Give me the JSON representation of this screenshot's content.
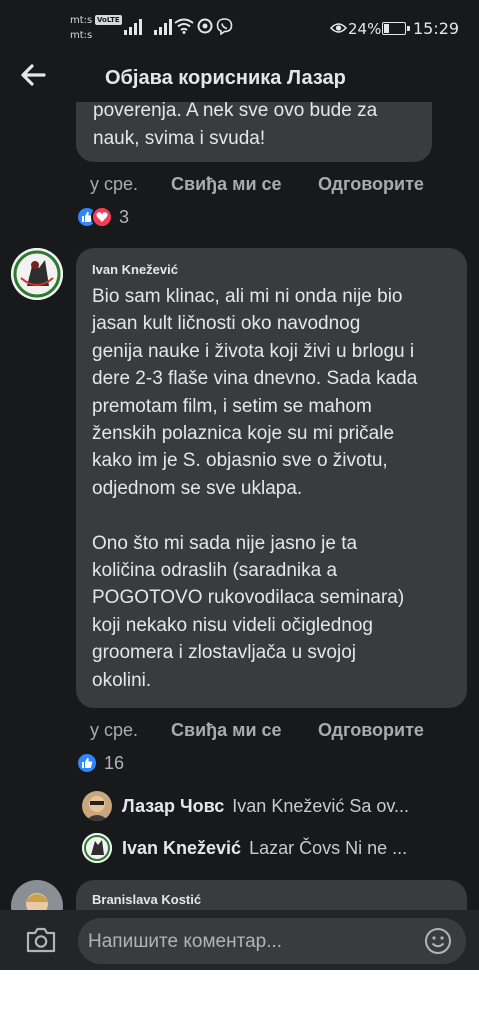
{
  "status_bar": {
    "operator_1": "mt:s",
    "operator_2": "mt:s",
    "volte_badge": "VoLTE",
    "battery_percent": "24%",
    "battery_level": 0.24,
    "time": "15:29"
  },
  "header": {
    "title": "Објава корисника Лазар"
  },
  "previous_comment": {
    "text": "poverenja. A nek sve ovo bude za\nnauk, svima i svuda!",
    "time": "у сре.",
    "like_label": "Свиђа ми се",
    "reply_label": "Одговорите",
    "reaction_icons": [
      "like-icon",
      "love-icon"
    ],
    "reaction_count": "3"
  },
  "main_comment": {
    "author": "Ivan Knežević",
    "text": "Bio sam klinac, ali mi ni onda nije bio\njasan kult ličnosti oko navodnog\ngenija nauke i života koji živi u brlogu i\ndere 2-3 flaše vina dnevno. Sada kada\npremotam film, i setim se mahom\nženskih polaznica koje su mi pričale\nkako im je S. objasnio sve o životu,\nodjednom se sve uklapa.\n\nOno što mi sada nije jasno je ta\nkoličina odraslih (saradnika a\nPOGOTOVO rukovodilaca seminara)\nkoji nekako nisu videli očiglednog\ngroomera i zlostavljača u svojoj\nokolini.",
    "time": "у сре.",
    "like_label": "Свиђа ми се",
    "reply_label": "Одговорите",
    "reaction_icons": [
      "like-icon"
    ],
    "reaction_count": "16"
  },
  "replies": [
    {
      "name": "Лазар Човс",
      "preview": "Ivan Knežević Sa ov..."
    },
    {
      "name": "Ivan Knežević",
      "preview": "Lazar Čovs Ni ne ..."
    }
  ],
  "next_comment": {
    "author": "Branislava Kostić"
  },
  "composer": {
    "placeholder": "Напишите коментар..."
  },
  "colors": {
    "background": "#18191a",
    "bubble": "#3a3b3c",
    "composer": "#242526",
    "like_blue": "#2d88ff",
    "love_red": "#f33e58"
  }
}
